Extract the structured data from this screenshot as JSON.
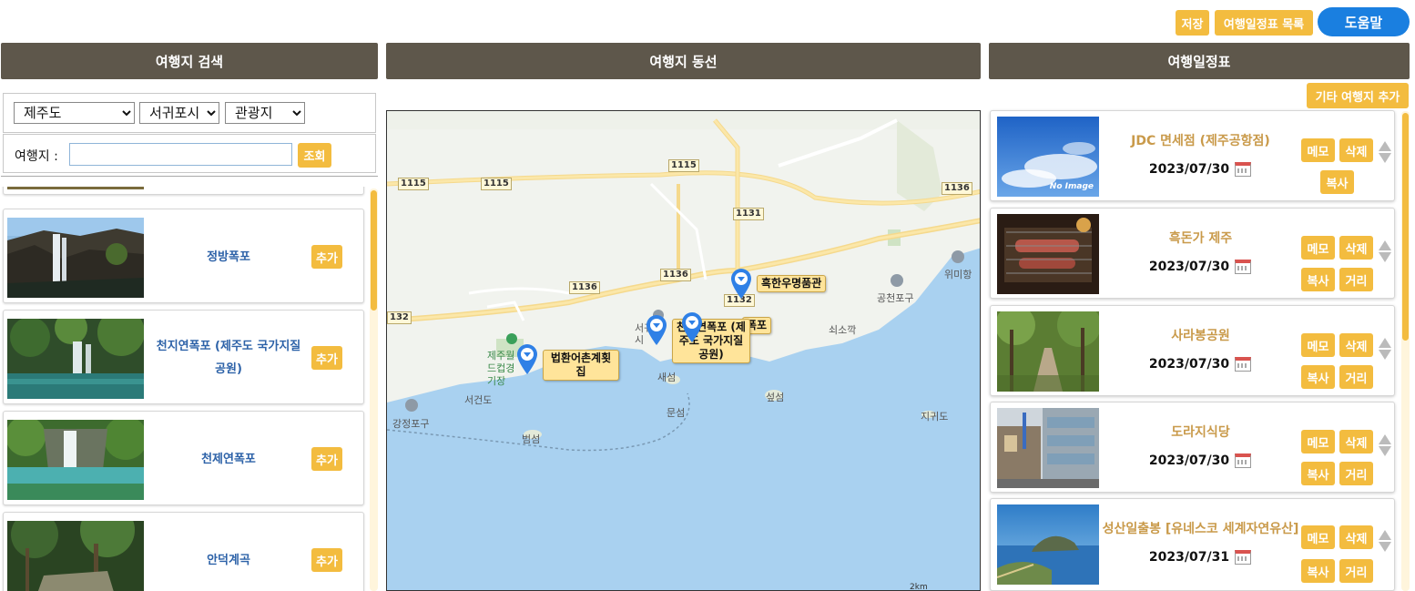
{
  "toolbar": {
    "save": "저장",
    "itinerary_list": "여행일정표 목록",
    "help": "도움말"
  },
  "panels": {
    "search_title": "여행지 검색",
    "route_title": "여행지 동선",
    "itinerary_title": "여행일정표"
  },
  "search": {
    "region": "제주도",
    "city": "서귀포시",
    "category": "관광지",
    "keyword_label": "여행지 :",
    "keyword_value": "",
    "query_button": "조회"
  },
  "results": [
    {
      "name": "정방폭포",
      "add": "추가",
      "icon": "waterfall-photo"
    },
    {
      "name": "천지연폭포 (제주도 국가지질공원)",
      "add": "추가",
      "icon": "waterfall-photo"
    },
    {
      "name": "천제연폭포",
      "add": "추가",
      "icon": "waterfall-photo"
    },
    {
      "name": "안덕계곡",
      "add": "추가",
      "icon": "valley-photo"
    }
  ],
  "itinerary": {
    "add_other": "기타 여행지 추가",
    "items": [
      {
        "title": "JDC 면세점 (제주공항점)",
        "date": "2023/07/30",
        "memo": "메모",
        "delete": "삭제",
        "copy": "복사",
        "distance": "",
        "thumb_caption": "No Image"
      },
      {
        "title": "흑돈가 제주",
        "date": "2023/07/30",
        "memo": "메모",
        "delete": "삭제",
        "copy": "복사",
        "distance": "거리"
      },
      {
        "title": "사라봉공원",
        "date": "2023/07/30",
        "memo": "메모",
        "delete": "삭제",
        "copy": "복사",
        "distance": "거리"
      },
      {
        "title": "도라지식당",
        "date": "2023/07/30",
        "memo": "메모",
        "delete": "삭제",
        "copy": "복사",
        "distance": "거리"
      },
      {
        "title": "성산일출봉 [유네스코 세계자연유산]",
        "date": "2023/07/31",
        "memo": "메모",
        "delete": "삭제",
        "copy": "복사",
        "distance": "거리"
      }
    ]
  },
  "map": {
    "markers": [
      {
        "label": "흑한우명품관"
      },
      {
        "label": "법환어촌계횟집"
      },
      {
        "label": "천지연폭포 (제주도 국가지질공원)"
      },
      {
        "label": "폭포"
      }
    ],
    "places": [
      "위미항",
      "공천포구",
      "쇠소깍",
      "제주월드컵경기장",
      "서건도",
      "강정포구",
      "범섬",
      "새섬",
      "문섬",
      "섶섬",
      "지귀도",
      "서귀포시"
    ],
    "roads": [
      "1115",
      "1115",
      "1115",
      "1136",
      "1131",
      "1136",
      "1136",
      "1132",
      "132"
    ],
    "scale": "2km"
  },
  "colors": {
    "header_bg": "#5e574b",
    "accent": "#f3bc3f",
    "help_bg": "#1a7fe0",
    "result_name": "#2d62a8",
    "itinerary_title": "#c99a4a"
  }
}
